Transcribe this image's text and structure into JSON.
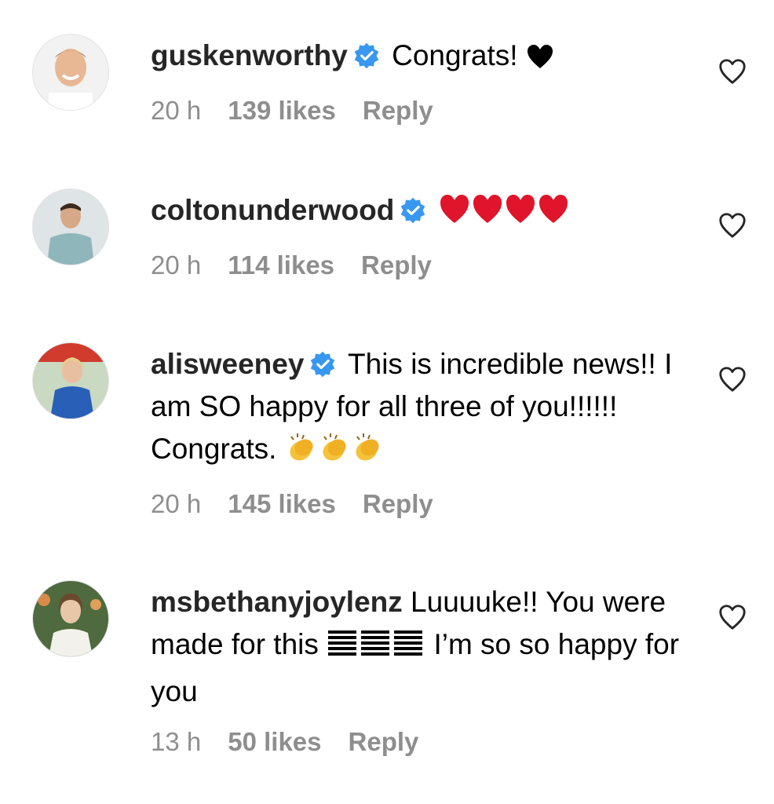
{
  "comments": [
    {
      "username": "guskenworthy",
      "verified": true,
      "text": "Congrats!",
      "emoji": "black-heart",
      "time": "20 h",
      "likes": "139 likes",
      "reply": "Reply"
    },
    {
      "username": "coltonunderwood",
      "verified": true,
      "text": "",
      "emoji": "red-heart x4",
      "time": "20 h",
      "likes": "114 likes",
      "reply": "Reply"
    },
    {
      "username": "alisweeney",
      "verified": true,
      "text": "This is incredible news!! I am SO happy for all three of you!!!!!! Congrats.",
      "emoji": "clapping-hands x3",
      "time": "20 h",
      "likes": "145 likes",
      "reply": "Reply"
    },
    {
      "username": "msbethanyjoylenz",
      "verified": false,
      "text_part1": "Luuuuke!! You were made for this",
      "emoji": "black-square-pattern x3",
      "text_part2": "I’m so so happy for you",
      "time": "13 h",
      "likes": "50 likes",
      "reply": "Reply"
    }
  ],
  "colors": {
    "verified_blue": "#3897f0",
    "meta_gray": "#8e8e8e",
    "heart_red": "#e0142a"
  }
}
